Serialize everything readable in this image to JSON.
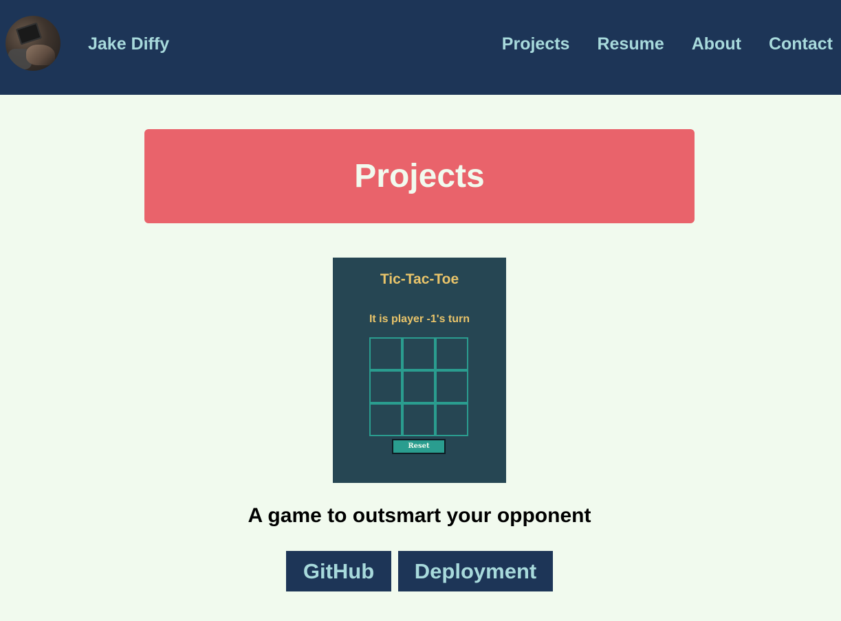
{
  "header": {
    "site_name": "Jake Diffy",
    "nav": [
      "Projects",
      "Resume",
      "About",
      "Contact"
    ]
  },
  "section": {
    "title": "Projects"
  },
  "project": {
    "preview": {
      "game_title": "Tic-Tac-Toe",
      "turn_text": "It is player -1's turn",
      "reset_label": "Reset"
    },
    "description": "A game to outsmart your opponent",
    "links": {
      "github": "GitHub",
      "deployment": "Deployment"
    }
  },
  "colors": {
    "header_bg": "#1d3557",
    "nav_text": "#a8dadc",
    "page_bg": "#f1faee",
    "banner_bg": "#e9636b",
    "preview_bg": "#264653",
    "preview_text": "#e9c46a",
    "board_lines": "#2a9d8f"
  }
}
